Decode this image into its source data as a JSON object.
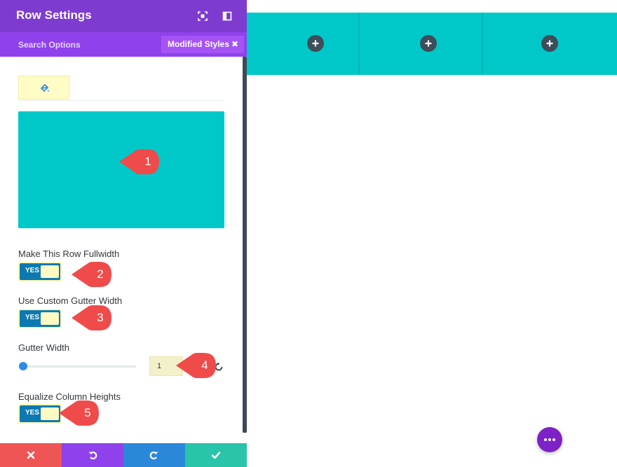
{
  "panel": {
    "title": "Row Settings",
    "search_placeholder": "Search Options",
    "filter_chip": "Modified Styles",
    "filter_chip_close": "✖",
    "tabs": [
      {
        "icon": "paint-bucket-icon"
      }
    ],
    "background_color": "#00C8C8"
  },
  "fields": {
    "fullwidth": {
      "label": "Make This Row Fullwidth",
      "value": "YES"
    },
    "custom_gutter": {
      "label": "Use Custom Gutter Width",
      "value": "YES"
    },
    "gutter_width": {
      "label": "Gutter Width",
      "value": "1",
      "slider_fraction": 0.0
    },
    "equalize": {
      "label": "Equalize Column Heights",
      "value": "YES"
    }
  },
  "callouts": [
    "1",
    "2",
    "3",
    "4",
    "5"
  ],
  "footer": [
    {
      "name": "discard",
      "icon": "close-icon",
      "color": "#EF5555"
    },
    {
      "name": "undo",
      "icon": "undo-icon",
      "color": "#8F42EC"
    },
    {
      "name": "redo",
      "icon": "redo-icon",
      "color": "#2B87DA"
    },
    {
      "name": "save",
      "icon": "check-icon",
      "color": "#29C4A9"
    }
  ],
  "colors": {
    "header": "#7E3BD0",
    "subbar": "#8F42EC",
    "accent_teal": "#00C8C8",
    "toggle_on": "#0C7AB0",
    "callout_red": "#EF4B4B",
    "fab": "#7E22C8"
  },
  "canvas": {
    "columns": 3,
    "add_icon": "plus-icon",
    "fab_icon": "more-dots-icon"
  }
}
